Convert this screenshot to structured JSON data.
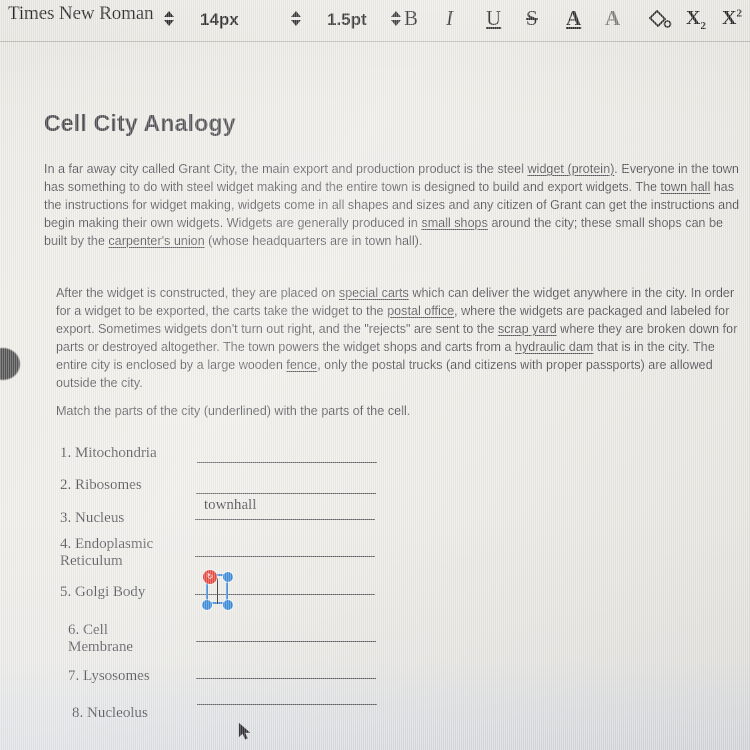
{
  "toolbar": {
    "font_family_value": "Times New Roman",
    "font_size_value": "14px",
    "line_spacing_value": "1.5pt",
    "bold_label": "B",
    "italic_label": "I",
    "underline_label": "U",
    "strikethrough_label": "S",
    "text_color_label": "A",
    "highlight_label": "A",
    "fill_color_label": "fill-bucket",
    "subscript_label": "X",
    "subscript_index": "2",
    "superscript_label": "X",
    "superscript_index": "2",
    "icons": {
      "font_family_stepper": "stepper-up-down-icon",
      "font_size_stepper": "stepper-up-down-icon",
      "line_spacing_stepper": "stepper-up-down-icon"
    }
  },
  "document": {
    "title": "Cell City Analogy",
    "paragraph1": {
      "part1": "In a far away city called Grant City, the main export and production product is the steel ",
      "u1": "widget (protein)",
      "part2": ". Everyone in the town has something to do with steel widget making and the entire town is designed to build and export widgets. The ",
      "u2": "town hall",
      "part3": " has the instructions for widget making, widgets come in all shapes and sizes and any citizen of Grant can get the instructions and begin making their own widgets. Widgets are generally produced in ",
      "u3": "small shops",
      "part4": " around the city; these small shops can be built by the ",
      "u4": "carpenter's union",
      "part5": " (whose headquarters are in town hall)."
    },
    "paragraph2": {
      "part1": "After the widget is constructed, they are placed on ",
      "u1": "special carts",
      "part2": " which can deliver the widget anywhere in the city. In order for a widget to be exported, the carts take the widget to the ",
      "u2": "postal office",
      "part3": ", where the widgets are packaged and labeled for export. Sometimes widgets don't turn out right, and the \"rejects\" are sent to the ",
      "u3": "scrap yard",
      "part4": " where they are broken down for parts or destroyed altogether. The town powers the widget shops and carts from a ",
      "u4": "hydraulic dam",
      "part5": " that is in the city. The entire city is enclosed by a large wooden ",
      "u5": "fence",
      "part6": ", only the postal trucks (and citizens with proper passports) are allowed outside the city."
    },
    "instruction": "Match the parts of the city (underlined) with the parts of the cell.",
    "match_items": [
      {
        "label": "1. Mitochondria",
        "answer": ""
      },
      {
        "label": "2. Ribosomes",
        "answer": ""
      },
      {
        "label": "3. Nucleus",
        "answer": "townhall"
      },
      {
        "label": "4. Endoplasmic\nReticulum",
        "answer": ""
      },
      {
        "label": "5. Golgi Body",
        "answer": ""
      },
      {
        "label": "6.  Cell\nMembrane",
        "answer": ""
      },
      {
        "label": "7. Lysosomes",
        "answer": ""
      },
      {
        "label": "8. Nucleolus",
        "answer": ""
      }
    ]
  },
  "overlay": {
    "selection_widget_name": "text-box-selection-handles",
    "rotate_handle_glyph": "↻",
    "cursor_name": "mouse-pointer"
  },
  "colors": {
    "background": "#ebe9e3",
    "text": "#4a4a50",
    "title": "#3b3b40",
    "handle_blue": "#1f7ad4",
    "handle_red": "#e02a1e",
    "rule_line": "#58585c"
  }
}
